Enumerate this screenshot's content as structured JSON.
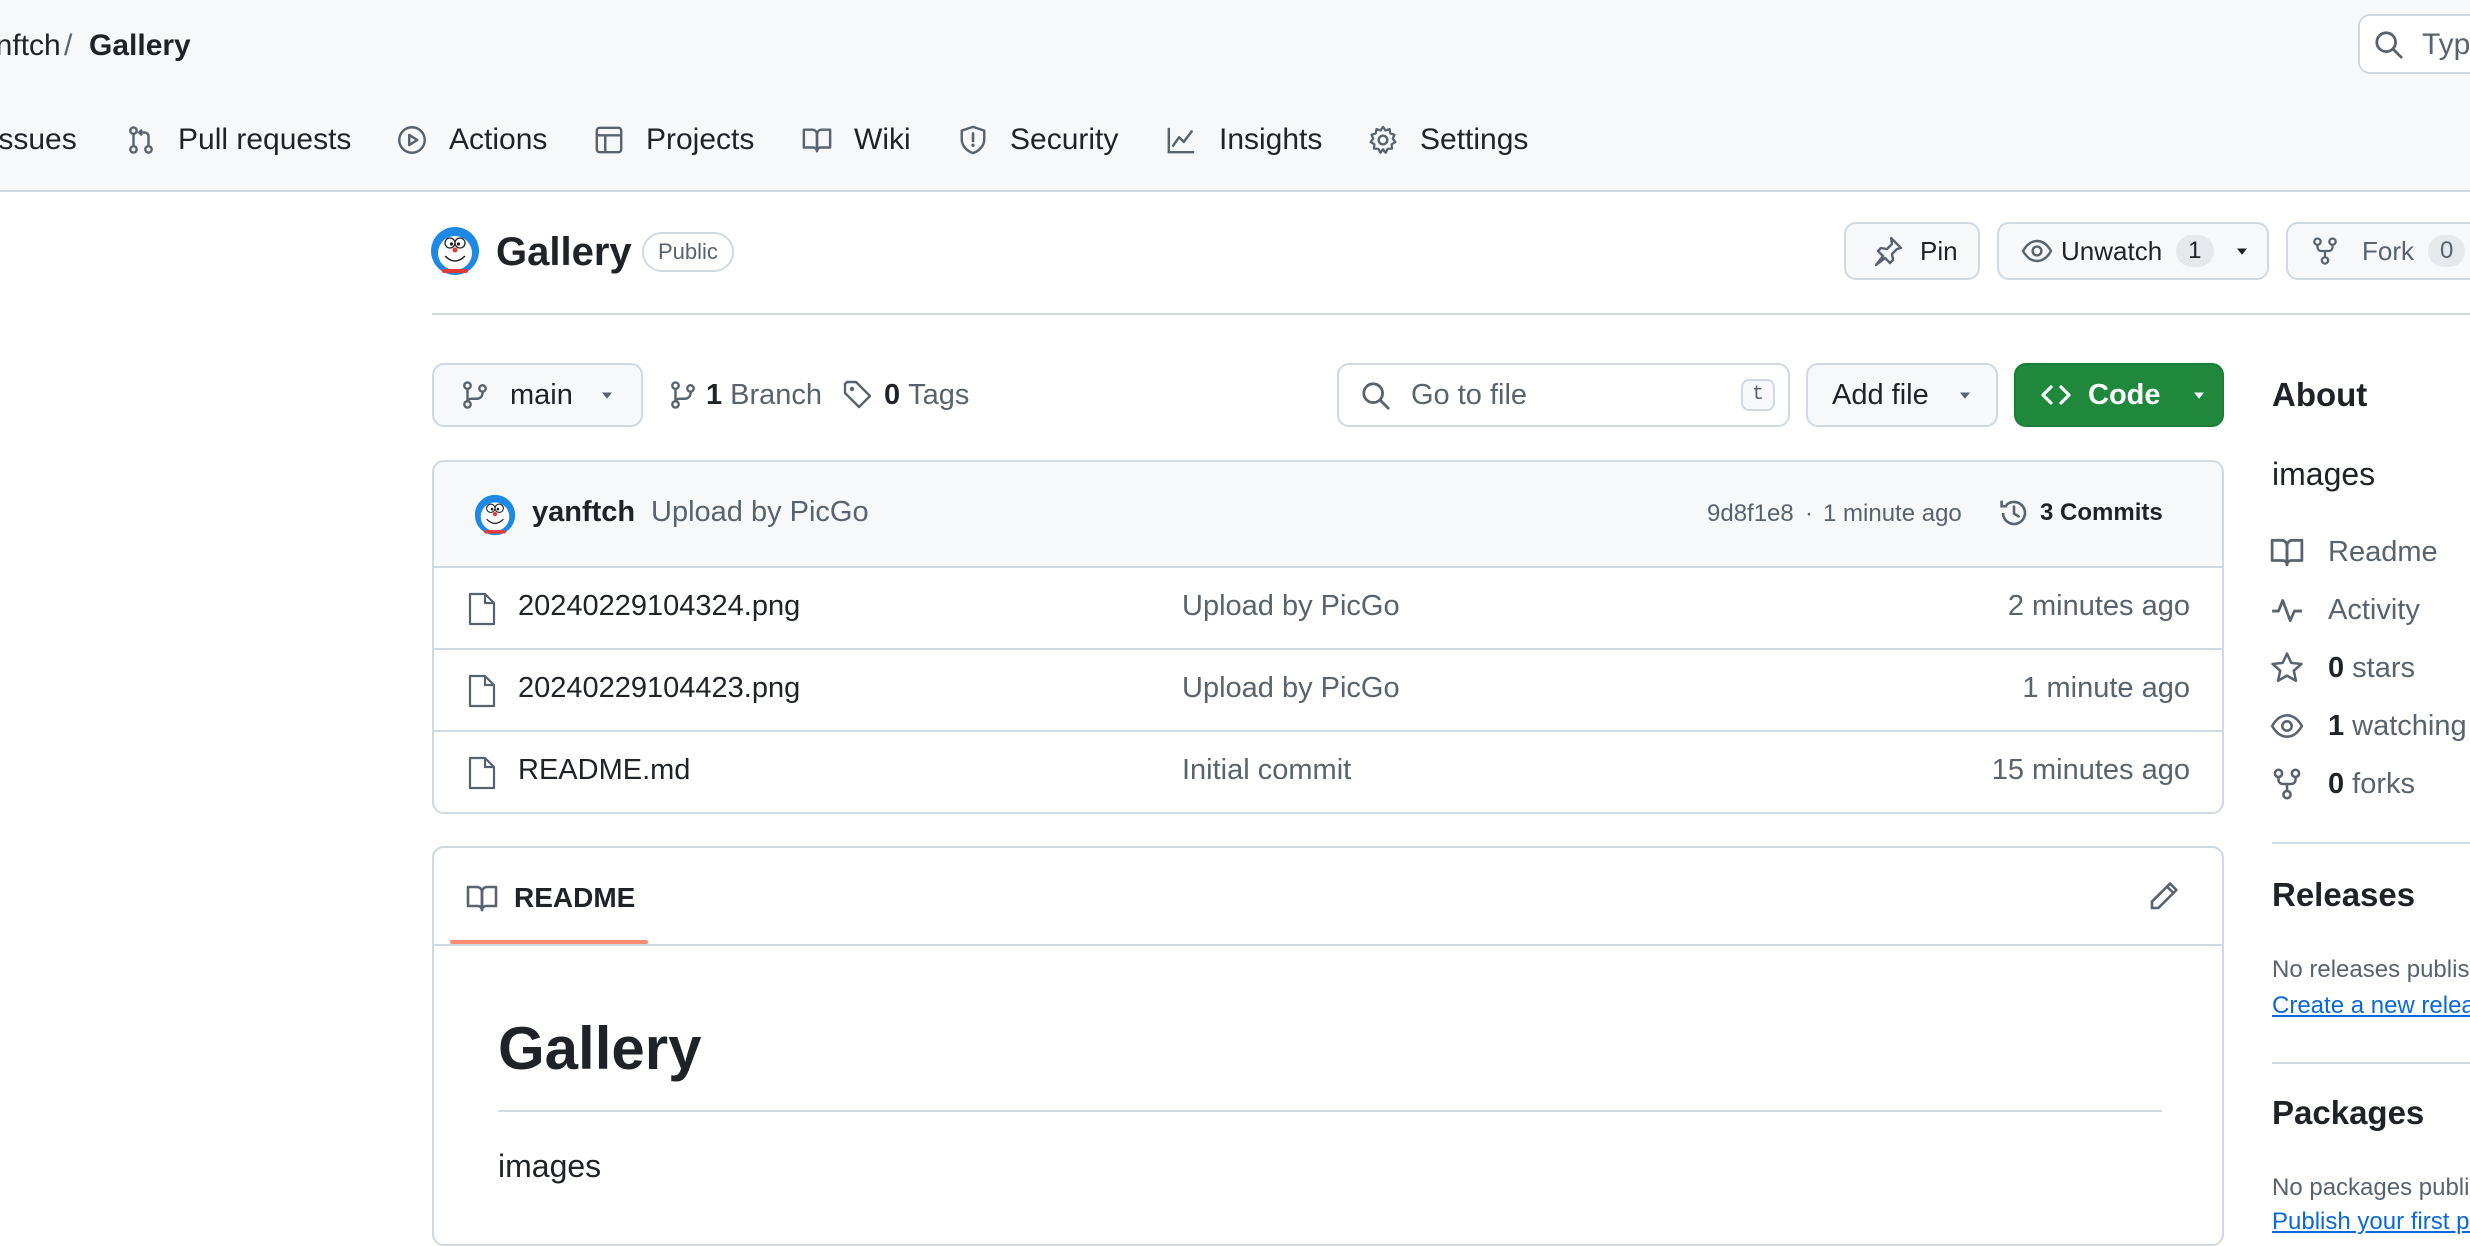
{
  "breadcrumb": {
    "owner": "yanftch",
    "separator": "/",
    "repo": "Gallery"
  },
  "search": {
    "placeholder": "Type"
  },
  "nav": [
    {
      "label": "Issues",
      "icon": "issue-icon"
    },
    {
      "label": "Pull requests",
      "icon": "pull-request-icon"
    },
    {
      "label": "Actions",
      "icon": "play-icon"
    },
    {
      "label": "Projects",
      "icon": "table-icon"
    },
    {
      "label": "Wiki",
      "icon": "book-icon"
    },
    {
      "label": "Security",
      "icon": "shield-icon"
    },
    {
      "label": "Insights",
      "icon": "graph-icon"
    },
    {
      "label": "Settings",
      "icon": "gear-icon"
    }
  ],
  "repo": {
    "name": "Gallery",
    "visibility": "Public"
  },
  "actions": {
    "pin": "Pin",
    "unwatch": "Unwatch",
    "watch_count": "1",
    "fork": "Fork",
    "fork_count": "0"
  },
  "toolbar": {
    "branch": "main",
    "branches_count": "1",
    "branches_label": "Branch",
    "tags_count": "0",
    "tags_label": "Tags",
    "goto_placeholder": "Go to file",
    "goto_shortcut": "t",
    "add_file": "Add file",
    "code": "Code"
  },
  "commit": {
    "author": "yanftch",
    "message": "Upload by PicGo",
    "hash": "9d8f1e8",
    "sep": "·",
    "time": "1 minute ago",
    "count_label": "3 Commits"
  },
  "files": [
    {
      "name": "20240229104324.png",
      "message": "Upload by PicGo",
      "time": "2 minutes ago"
    },
    {
      "name": "20240229104423.png",
      "message": "Upload by PicGo",
      "time": "1 minute ago"
    },
    {
      "name": "README.md",
      "message": "Initial commit",
      "time": "15 minutes ago"
    }
  ],
  "readme": {
    "tab": "README",
    "heading": "Gallery",
    "body": "images"
  },
  "about": {
    "title": "About",
    "description": "images",
    "readme": "Readme",
    "activity": "Activity",
    "stars_count": "0",
    "stars_label": "stars",
    "watching_count": "1",
    "watching_label": "watching",
    "forks_count": "0",
    "forks_label": "forks"
  },
  "releases": {
    "title": "Releases",
    "empty": "No releases published",
    "create_link": "Create a new release"
  },
  "packages": {
    "title": "Packages",
    "empty": "No packages published",
    "publish_link": "Publish your first package"
  },
  "colors": {
    "primary_green": "#1f883d",
    "link_blue": "#0969da",
    "tab_underline": "#fd8c73"
  }
}
